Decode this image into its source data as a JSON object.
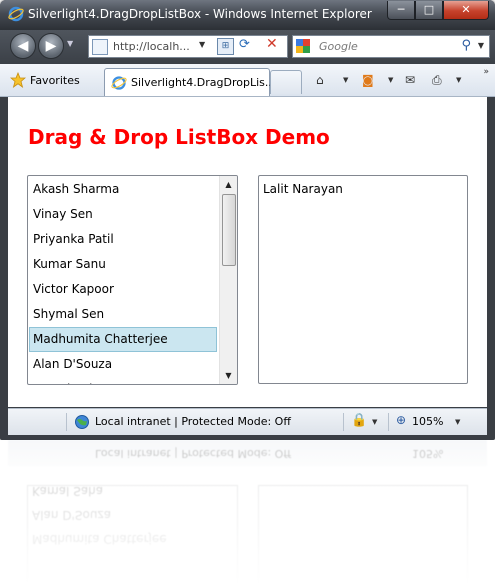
{
  "window": {
    "title": "Silverlight4.DragDropListBox - Windows Internet Explorer",
    "controls": {
      "minimize": "─",
      "maximize": "□",
      "close": "✕"
    }
  },
  "navbar": {
    "address": "http://localh...",
    "search_placeholder": "Google"
  },
  "tabbar": {
    "favorites_label": "Favorites",
    "active_tab_title": "Silverlight4.DragDropLis..."
  },
  "content": {
    "heading": "Drag & Drop ListBox Demo",
    "left_list": [
      "Akash Sharma",
      "Vinay Sen",
      "Priyanka Patil",
      "Kumar Sanu",
      "Victor Kapoor",
      "Shymal Sen",
      "Madhumita Chatterjee",
      "Alan D'Souza",
      "Kamal Saha"
    ],
    "left_selected_index": 6,
    "right_list": [
      "Lalit Narayan"
    ]
  },
  "statusbar": {
    "zone": "Local intranet | Protected Mode: Off",
    "zoom": "105%"
  },
  "colors": {
    "heading": "#ff0000",
    "selection_bg": "#cbe6f0",
    "selection_border": "#8fc3d7",
    "frame": "#3a3e44"
  },
  "icons": {
    "title": "ie-logo-icon",
    "back": "back-arrow-icon",
    "forward": "forward-arrow-icon",
    "compat": "compatibility-view-icon",
    "refresh": "refresh-icon",
    "stop": "stop-icon",
    "search": "magnifier-icon",
    "favorites": "star-icon",
    "home": "home-icon",
    "feeds": "rss-feed-icon",
    "mail": "mail-icon",
    "print": "printer-icon",
    "zone": "intranet-globe-icon",
    "security": "security-lock-icon",
    "zoom": "zoom-icon"
  }
}
